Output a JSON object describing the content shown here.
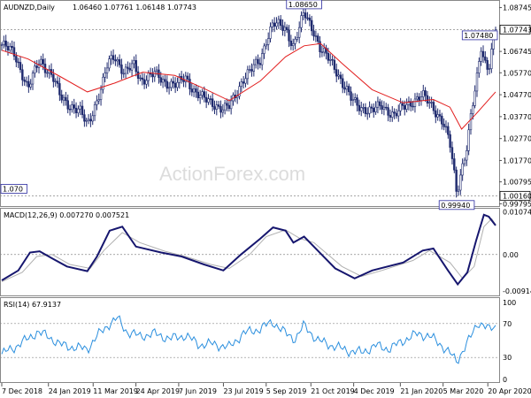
{
  "header": {
    "symbol": "AUDNZD,Daily",
    "ohlc": "1.06460 1.07761 1.06148 1.07743"
  },
  "watermark": "ActionForex.com",
  "colors": {
    "background": "#ffffff",
    "candle": "#1f2a6e",
    "ma": "#e21d1d",
    "macd_line": "#16166e",
    "signal_line": "#b0b0b0",
    "rsi_line": "#2b8fde",
    "grid": "#8a8a8a"
  },
  "chart_data": [
    {
      "type": "candlestick",
      "panel": "price",
      "y_ticks": [
        "1.08745",
        "1.07743",
        "1.06745",
        "1.05770",
        "1.04770",
        "1.03770",
        "1.02770",
        "1.01770",
        "1.00795",
        "0.99795"
      ],
      "y_tick_values": [
        1.08745,
        1.07743,
        1.06745,
        1.0577,
        1.0477,
        1.0377,
        1.0277,
        1.0177,
        1.00795,
        0.99795
      ],
      "ylim": [
        0.9965,
        1.0905
      ],
      "current_price": 1.07743,
      "current_price_label": "1.07743",
      "reference_level": 1.0016,
      "reference_label": "1.00160",
      "annotations": [
        {
          "text": "1.08650",
          "date": "2019-10-14",
          "value": 1.0865
        },
        {
          "text": "1.07480",
          "date": "2020-04-13",
          "value": 1.0748
        },
        {
          "text": "0.99940",
          "date": "2020-03-19",
          "value": 0.9994
        },
        {
          "text": "1.070",
          "date": "2018-12-07",
          "value": 1.0048
        }
      ],
      "close_path": [
        [
          "2018-12-07",
          1.0705
        ],
        [
          "2018-12-20",
          1.0665
        ],
        [
          "2018-12-28",
          1.0575
        ],
        [
          "2019-01-03",
          1.05
        ],
        [
          "2019-01-15",
          1.064
        ],
        [
          "2019-01-28",
          1.056
        ],
        [
          "2019-02-05",
          1.047
        ],
        [
          "2019-02-15",
          1.043
        ],
        [
          "2019-02-26",
          1.0395
        ],
        [
          "2019-03-05",
          1.034
        ],
        [
          "2019-03-12",
          1.042
        ],
        [
          "2019-03-20",
          1.051
        ],
        [
          "2019-03-26",
          1.0615
        ],
        [
          "2019-04-02",
          1.066
        ],
        [
          "2019-04-12",
          1.0575
        ],
        [
          "2019-04-22",
          1.061
        ],
        [
          "2019-04-29",
          1.0545
        ],
        [
          "2019-05-13",
          1.057
        ],
        [
          "2019-05-24",
          1.0535
        ],
        [
          "2019-06-05",
          1.052
        ],
        [
          "2019-06-14",
          1.0555
        ],
        [
          "2019-06-24",
          1.049
        ],
        [
          "2019-07-03",
          1.0455
        ],
        [
          "2019-07-12",
          1.044
        ],
        [
          "2019-07-23",
          1.041
        ],
        [
          "2019-07-29",
          1.042
        ],
        [
          "2019-08-05",
          1.048
        ],
        [
          "2019-08-12",
          1.055
        ],
        [
          "2019-08-19",
          1.058
        ],
        [
          "2019-08-30",
          1.0635
        ],
        [
          "2019-09-05",
          1.073
        ],
        [
          "2019-09-12",
          1.08
        ],
        [
          "2019-09-25",
          1.078
        ],
        [
          "2019-10-03",
          1.07
        ],
        [
          "2019-10-10",
          1.079
        ],
        [
          "2019-10-14",
          1.085
        ],
        [
          "2019-10-24",
          1.077
        ],
        [
          "2019-10-31",
          1.068
        ],
        [
          "2019-11-08",
          1.064
        ],
        [
          "2019-11-15",
          1.06
        ],
        [
          "2019-11-22",
          1.0535
        ],
        [
          "2019-12-02",
          1.045
        ],
        [
          "2019-12-12",
          1.042
        ],
        [
          "2019-12-23",
          1.04
        ],
        [
          "2020-01-02",
          1.043
        ],
        [
          "2020-01-15",
          1.038
        ],
        [
          "2020-01-24",
          1.042
        ],
        [
          "2020-02-03",
          1.045
        ],
        [
          "2020-02-13",
          1.047
        ],
        [
          "2020-02-24",
          1.042
        ],
        [
          "2020-03-05",
          1.035
        ],
        [
          "2020-03-12",
          1.025
        ],
        [
          "2020-03-16",
          1.013
        ],
        [
          "2020-03-19",
          1.003
        ],
        [
          "2020-03-24",
          1.014
        ],
        [
          "2020-03-30",
          1.025
        ],
        [
          "2020-04-03",
          1.039
        ],
        [
          "2020-04-08",
          1.052
        ],
        [
          "2020-04-13",
          1.07
        ],
        [
          "2020-04-16",
          1.064
        ],
        [
          "2020-04-21",
          1.06
        ],
        [
          "2020-04-24",
          1.068
        ],
        [
          "2020-04-28",
          1.0774
        ]
      ],
      "ma_path": [
        [
          "2018-12-07",
          1.068
        ],
        [
          "2019-01-03",
          1.064
        ],
        [
          "2019-02-05",
          1.056
        ],
        [
          "2019-03-05",
          1.049
        ],
        [
          "2019-04-02",
          1.053
        ],
        [
          "2019-05-01",
          1.058
        ],
        [
          "2019-06-03",
          1.0565
        ],
        [
          "2019-07-03",
          1.0505
        ],
        [
          "2019-07-29",
          1.045
        ],
        [
          "2019-08-30",
          1.054
        ],
        [
          "2019-09-25",
          1.065
        ],
        [
          "2019-10-14",
          1.07
        ],
        [
          "2019-10-31",
          1.071
        ],
        [
          "2019-11-22",
          1.062
        ],
        [
          "2019-12-23",
          1.05
        ],
        [
          "2020-01-24",
          1.044
        ],
        [
          "2020-02-24",
          1.0455
        ],
        [
          "2020-03-12",
          1.042
        ],
        [
          "2020-03-24",
          1.032
        ],
        [
          "2020-04-08",
          1.039
        ],
        [
          "2020-04-28",
          1.049
        ]
      ]
    },
    {
      "type": "line",
      "panel": "macd",
      "title": "MACD(12,26,9) 0.007270 0.007521",
      "y_ticks": [
        "0.010744",
        "0.00",
        "-0.009148"
      ],
      "y_tick_values": [
        0.010744,
        0,
        -0.009148
      ],
      "ylim": [
        -0.0105,
        0.0115
      ],
      "series": [
        {
          "name": "MACD",
          "points": [
            [
              "2018-12-07",
              -0.0065
            ],
            [
              "2018-12-24",
              -0.004
            ],
            [
              "2019-01-05",
              0.0005
            ],
            [
              "2019-01-15",
              0.0008
            ],
            [
              "2019-01-28",
              -0.001
            ],
            [
              "2019-02-12",
              -0.003
            ],
            [
              "2019-03-05",
              -0.0042
            ],
            [
              "2019-03-15",
              -0.0005
            ],
            [
              "2019-03-28",
              0.006
            ],
            [
              "2019-04-10",
              0.007
            ],
            [
              "2019-04-24",
              0.002
            ],
            [
              "2019-05-20",
              0.0005
            ],
            [
              "2019-06-10",
              -0.0005
            ],
            [
              "2019-07-03",
              -0.0025
            ],
            [
              "2019-07-23",
              -0.004
            ],
            [
              "2019-08-10",
              0.0
            ],
            [
              "2019-08-30",
              0.004
            ],
            [
              "2019-09-12",
              0.0068
            ],
            [
              "2019-09-25",
              0.006
            ],
            [
              "2019-10-03",
              0.003
            ],
            [
              "2019-10-14",
              0.0045
            ],
            [
              "2019-10-28",
              0.001
            ],
            [
              "2019-11-15",
              -0.0035
            ],
            [
              "2019-12-05",
              -0.006
            ],
            [
              "2019-12-23",
              -0.004
            ],
            [
              "2020-01-24",
              -0.002
            ],
            [
              "2020-02-13",
              0.001
            ],
            [
              "2020-02-24",
              0.0015
            ],
            [
              "2020-03-10",
              -0.004
            ],
            [
              "2020-03-20",
              -0.0075
            ],
            [
              "2020-03-30",
              -0.0045
            ],
            [
              "2020-04-08",
              0.0035
            ],
            [
              "2020-04-16",
              0.01
            ],
            [
              "2020-04-21",
              0.0095
            ],
            [
              "2020-04-28",
              0.0073
            ]
          ]
        },
        {
          "name": "Signal",
          "points": [
            [
              "2018-12-07",
              -0.0068
            ],
            [
              "2018-12-28",
              -0.0045
            ],
            [
              "2019-01-12",
              -0.0005
            ],
            [
              "2019-01-28",
              0.0
            ],
            [
              "2019-02-15",
              -0.0025
            ],
            [
              "2019-03-08",
              -0.0035
            ],
            [
              "2019-03-22",
              0.001
            ],
            [
              "2019-04-10",
              0.0055
            ],
            [
              "2019-04-28",
              0.003
            ],
            [
              "2019-05-24",
              0.0008
            ],
            [
              "2019-06-14",
              -0.0005
            ],
            [
              "2019-07-10",
              -0.0025
            ],
            [
              "2019-07-29",
              -0.0035
            ],
            [
              "2019-08-19",
              0.0
            ],
            [
              "2019-09-05",
              0.0045
            ],
            [
              "2019-09-25",
              0.0062
            ],
            [
              "2019-10-10",
              0.004
            ],
            [
              "2019-10-24",
              0.003
            ],
            [
              "2019-11-22",
              -0.003
            ],
            [
              "2019-12-12",
              -0.0055
            ],
            [
              "2020-01-02",
              -0.004
            ],
            [
              "2020-02-03",
              -0.0015
            ],
            [
              "2020-02-20",
              0.001
            ],
            [
              "2020-03-12",
              -0.002
            ],
            [
              "2020-03-25",
              -0.006
            ],
            [
              "2020-04-06",
              -0.003
            ],
            [
              "2020-04-16",
              0.007
            ],
            [
              "2020-04-24",
              0.009
            ],
            [
              "2020-04-28",
              0.0075
            ]
          ]
        }
      ]
    },
    {
      "type": "line",
      "panel": "rsi",
      "title": "RSI(14) 67.9137",
      "y_ticks": [
        "100",
        "70",
        "30",
        "0"
      ],
      "y_tick_values": [
        100,
        70,
        30,
        0
      ],
      "ylim": [
        0,
        100
      ],
      "series": [
        {
          "name": "RSI",
          "points": [
            [
              "2018-12-07",
              34
            ],
            [
              "2018-12-20",
              42
            ],
            [
              "2019-01-03",
              52
            ],
            [
              "2019-01-12",
              60
            ],
            [
              "2019-01-24",
              55
            ],
            [
              "2019-02-05",
              45
            ],
            [
              "2019-02-19",
              42
            ],
            [
              "2019-03-05",
              40
            ],
            [
              "2019-03-15",
              55
            ],
            [
              "2019-03-28",
              70
            ],
            [
              "2019-04-05",
              76
            ],
            [
              "2019-04-15",
              60
            ],
            [
              "2019-04-28",
              55
            ],
            [
              "2019-05-13",
              58
            ],
            [
              "2019-05-29",
              52
            ],
            [
              "2019-06-14",
              56
            ],
            [
              "2019-06-28",
              45
            ],
            [
              "2019-07-12",
              46
            ],
            [
              "2019-07-29",
              42
            ],
            [
              "2019-08-12",
              58
            ],
            [
              "2019-08-30",
              64
            ],
            [
              "2019-09-12",
              72
            ],
            [
              "2019-09-25",
              58
            ],
            [
              "2019-10-05",
              52
            ],
            [
              "2019-10-14",
              68
            ],
            [
              "2019-10-28",
              50
            ],
            [
              "2019-11-12",
              44
            ],
            [
              "2019-11-28",
              38
            ],
            [
              "2019-12-12",
              36
            ],
            [
              "2019-12-27",
              44
            ],
            [
              "2020-01-10",
              40
            ],
            [
              "2020-01-24",
              50
            ],
            [
              "2020-02-08",
              58
            ],
            [
              "2020-02-20",
              55
            ],
            [
              "2020-03-03",
              45
            ],
            [
              "2020-03-12",
              35
            ],
            [
              "2020-03-19",
              25
            ],
            [
              "2020-03-26",
              40
            ],
            [
              "2020-04-03",
              55
            ],
            [
              "2020-04-10",
              72
            ],
            [
              "2020-04-16",
              68
            ],
            [
              "2020-04-22",
              62
            ],
            [
              "2020-04-28",
              68
            ]
          ]
        }
      ]
    }
  ],
  "x_axis": {
    "tick_labels": [
      "7 Dec 2018",
      "24 Jan 2019",
      "11 Mar 2019",
      "24 Apr 2019",
      "7 Jun 2019",
      "23 Jul 2019",
      "5 Sep 2019",
      "21 Oct 2019",
      "4 Dec 2019",
      "21 Jan 2020",
      "5 Mar 2020",
      "20 Apr 2020"
    ],
    "tick_dates": [
      "2018-12-07",
      "2019-01-24",
      "2019-03-11",
      "2019-04-24",
      "2019-06-07",
      "2019-07-23",
      "2019-09-05",
      "2019-10-21",
      "2019-12-04",
      "2020-01-21",
      "2020-03-05",
      "2020-04-20"
    ],
    "range": [
      "2018-12-07",
      "2020-04-28"
    ]
  }
}
